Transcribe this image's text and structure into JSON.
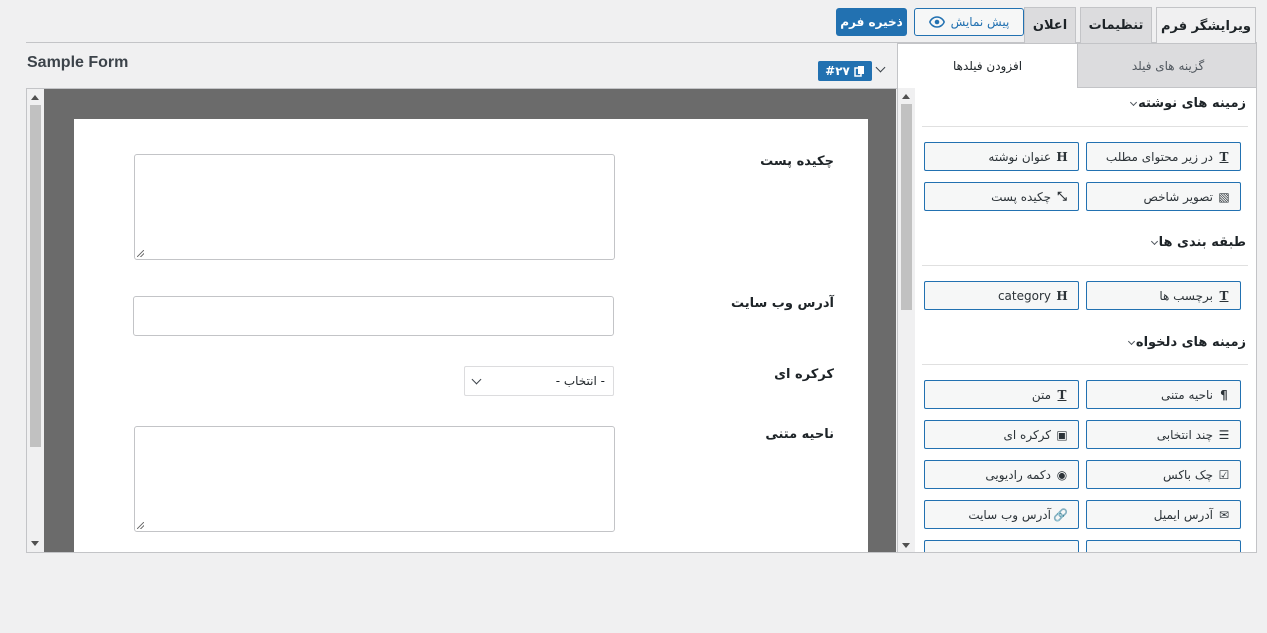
{
  "tabs": {
    "editor": "ویرایشگر فرم",
    "settings": "تنظیمات",
    "notification": "اعلان"
  },
  "actions": {
    "preview": "پیش نمایش",
    "save": "ذخیره فرم"
  },
  "form": {
    "title": "Sample Form",
    "id_badge": "#۲۷"
  },
  "form_fields": [
    {
      "label": "چکیده پست",
      "type": "textarea"
    },
    {
      "label": "آدرس وب سایت",
      "type": "input"
    },
    {
      "label": "کرکره ای",
      "type": "select",
      "value": "- انتخاب -"
    },
    {
      "label": "ناحیه متنی",
      "type": "textarea"
    }
  ],
  "panel": {
    "tab_options": "گزینه های فیلد",
    "tab_add": "افزودن فیلدها",
    "sections": [
      {
        "title": "زمینه های نوشته",
        "buttons": [
          {
            "label": "در زیر محتوای مطلب",
            "icon": "text-icon"
          },
          {
            "label": "عنوان نوشته",
            "icon": "heading-icon"
          },
          {
            "label": "تصویر شاخص",
            "icon": "image-icon"
          },
          {
            "label": "چکیده پست",
            "icon": "compress-icon"
          }
        ]
      },
      {
        "title": "طبقه بندی ها",
        "buttons": [
          {
            "label": "برچسب ها",
            "icon": "text-icon"
          },
          {
            "label": "category",
            "icon": "heading-icon"
          }
        ]
      },
      {
        "title": "زمینه های دلخواه",
        "buttons": [
          {
            "label": "ناحیه متنی",
            "icon": "paragraph-icon"
          },
          {
            "label": "متن",
            "icon": "text-icon"
          },
          {
            "label": "چند انتخابی",
            "icon": "list-icon"
          },
          {
            "label": "کرکره ای",
            "icon": "dropdown-icon"
          },
          {
            "label": "چک باکس",
            "icon": "checkbox-icon"
          },
          {
            "label": "دکمه رادیویی",
            "icon": "radio-icon"
          },
          {
            "label": "آدرس ایمیل",
            "icon": "envelope-icon"
          },
          {
            "label": "آدرس وب سایت",
            "icon": "link-icon"
          }
        ]
      }
    ]
  },
  "colors": {
    "primary": "#2271b1",
    "stage": "#6b6b6b",
    "background": "#f0f0f1"
  }
}
